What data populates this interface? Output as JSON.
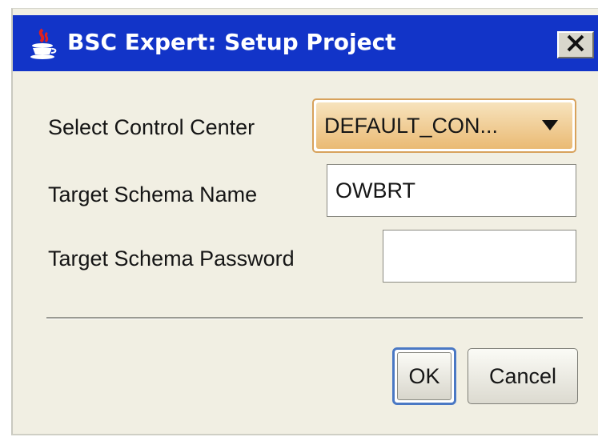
{
  "window": {
    "title": "BSC Expert: Setup Project",
    "close_glyph": "X",
    "icon": "java-icon"
  },
  "form": {
    "control_center_label": "Select Control Center",
    "control_center_value": "DEFAULT_CON...",
    "schema_name_label": "Target Schema Name",
    "schema_name_value": "OWBRT",
    "schema_password_label": "Target Schema Password",
    "schema_password_value": ""
  },
  "buttons": {
    "ok_label": "OK",
    "cancel_label": "Cancel"
  },
  "colors": {
    "titlebar": "#1234c8",
    "dialog_background": "#f1efe3",
    "combo_highlight": "#eaba74",
    "focus_border": "#4a78c4"
  }
}
